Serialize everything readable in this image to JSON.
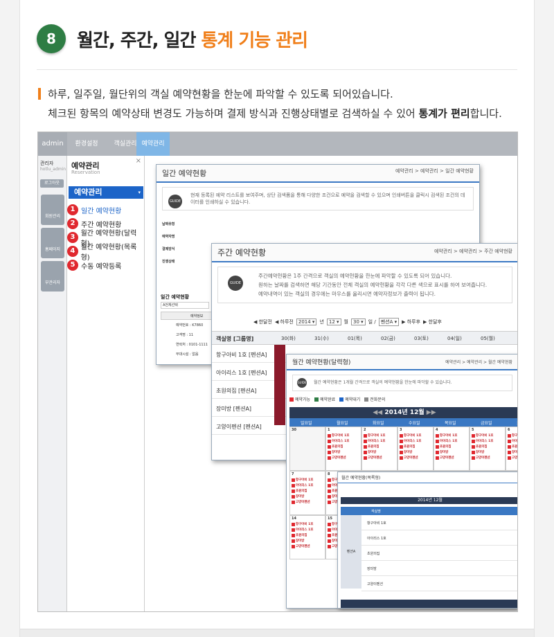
{
  "section": {
    "number": "8",
    "title_main": "월간, 주간, 일간 ",
    "title_highlight": "통계 기능 관리"
  },
  "description": {
    "line1": "하루, 일주일, 월단위의 객실 예약현황을 한눈에 파악할 수 있도록 되어있습니다.",
    "line2_prefix": "체크된 항목의 예약상태 변경도 가능하며 결제 방식과 진행상태별로 검색하실 수 있어 ",
    "line2_bold": "통계가 편리",
    "line2_suffix": "합니다."
  },
  "screenshot": {
    "topnav": {
      "admin": "admin",
      "tabs": [
        "환경설정",
        "객실관리",
        "예약관리"
      ]
    },
    "left": {
      "manager_label": "관리자",
      "manager_id": "hotlu_admin",
      "logout": "로그아웃",
      "btn_labels": [
        "회원관리",
        "홈페이지",
        "부관리자"
      ]
    },
    "menu": {
      "title": "예약관리",
      "subtitle": "Reservation",
      "active": "예약관리",
      "items": [
        {
          "num": "1",
          "label": "일간 예약현황"
        },
        {
          "num": "2",
          "label": "주간 예약현황"
        },
        {
          "num": "3",
          "label": "월간 예약현황(달력형)"
        },
        {
          "num": "4",
          "label": "월간 예약현황(목록형)"
        },
        {
          "num": "5",
          "label": "수동 예약등록"
        }
      ]
    },
    "daily": {
      "title": "일간 예약현황",
      "crumb": "예약관리 > 예약관리 > 일간 예약현황",
      "guide": "현재 등록된 예약 리스트를 보여주며, 상단 검색폼을 통해 다양한 조건으로 예약을 검색할 수 있으며 인쇄버튼을 클릭시 검색된 조건의 데이터를 인쇄하실 수 있습니다.",
      "form_labels": [
        "날짜유형",
        "예약자명",
        "결제방식",
        "진행상태"
      ],
      "list_title": "일간 예약현황",
      "table_headers": [
        "",
        "예약정보"
      ],
      "reserve_fields": [
        "예약번호 : K7860",
        "고객명 : 11",
        "연락처 : 0101-1111",
        "부대시설 : 없음"
      ],
      "sel_all": "A전체선택"
    },
    "weekly": {
      "title": "주간 예약현황",
      "crumb": "예약관리 > 예약관리 > 주간 예약현황",
      "guide": [
        "주간예약현황은 1주 간격으로 객실의 예약현황을 한눈에 파악할 수 있도록 되어 있습니다.",
        "원하는 날짜를 검색하면 해당 기간동안 전체 객실의 예약현황을 각각 다른 색으로 표시를 하여 보여줍니다.",
        "예약내역이 있는 객실의 경우에는 마우스를 올리시면 예약자정보가 출력이 됩니다."
      ],
      "nav": {
        "prev_month": "한달전",
        "prev_week": "하루전",
        "year": "2014",
        "month": "12",
        "day": "30",
        "room": "펜션A",
        "next_day": "하루후",
        "next_month": "한달후"
      },
      "col_header": "객실명 [그룹명]",
      "days": [
        "30(화)",
        "31(수)",
        "01(목)",
        "02(금)",
        "03(토)",
        "04(일)",
        "05(월)"
      ],
      "rooms": [
        "항구아비 1호 [펜션A]",
        "아이리스 1호 [펜션A]",
        "초원의집 [펜션A]",
        "장미방 [펜션A]",
        "고양이펜션 [펜션A]"
      ]
    },
    "monthly": {
      "title": "월간 예약현황(달력형)",
      "crumb": "예약관리 > 예약관리 > 월간 예약현황",
      "guide": "월간 예약현황은 1개월 간격으로 객실의 예약현황을 한눈에 파악할 수 있습니다.",
      "legend": [
        "예약가능",
        "예약완료",
        "예약대기",
        "전화문의"
      ],
      "month_title": "2014년 12월",
      "weekdays": [
        "일요일",
        "월요일",
        "화요일",
        "수요일",
        "목요일",
        "금요일",
        "토"
      ],
      "room_items": [
        "항구아비 1호",
        "아이리스 1호",
        "초원의집",
        "장미방",
        "고양이펜션"
      ],
      "dates": [
        "30",
        "1",
        "2",
        "3",
        "4",
        "5",
        "6",
        "7",
        "8",
        "9",
        "10",
        "11",
        "12",
        "13",
        "14",
        "15"
      ]
    },
    "list": {
      "title": "월간 예약현황(목록형)",
      "month_title": "2014년 12월",
      "col": "객실명",
      "group": "펜션A",
      "rooms": [
        "항구아비 1호",
        "아이리스 1호",
        "초원의집",
        "장미방",
        "고양이펜션"
      ]
    }
  },
  "colors": {
    "accent": "#f07f1a",
    "green_badge": "#2e7d44",
    "blue": "#3a78c3",
    "dark_nav": "#2a3a55",
    "red_badge": "#e0282f"
  }
}
